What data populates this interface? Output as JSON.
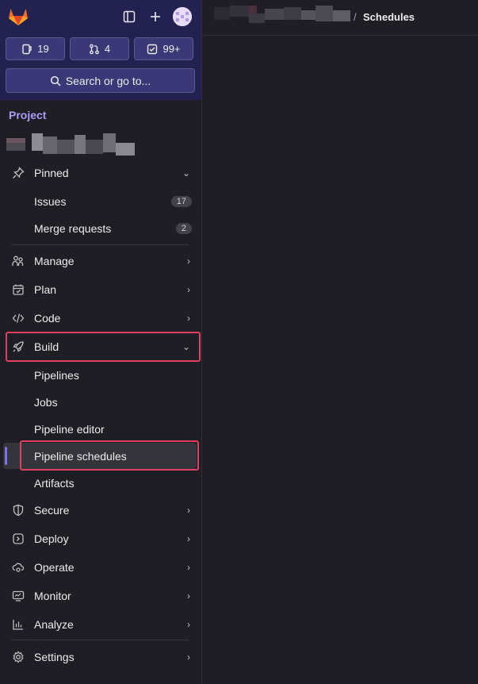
{
  "topbar": {
    "counters": [
      {
        "icon": "issues-icon",
        "value": "19"
      },
      {
        "icon": "merge-request-icon",
        "value": "4"
      },
      {
        "icon": "todo-icon",
        "value": "99+"
      }
    ],
    "search_label": "Search or go to..."
  },
  "sidebar": {
    "context_label": "Project",
    "pinned": {
      "label": "Pinned",
      "items": [
        {
          "label": "Issues",
          "count": "17"
        },
        {
          "label": "Merge requests",
          "count": "2"
        }
      ]
    },
    "sections": {
      "manage": "Manage",
      "plan": "Plan",
      "code": "Code",
      "build": "Build",
      "secure": "Secure",
      "deploy": "Deploy",
      "operate": "Operate",
      "monitor": "Monitor",
      "analyze": "Analyze",
      "settings": "Settings"
    },
    "build_items": [
      "Pipelines",
      "Jobs",
      "Pipeline editor",
      "Pipeline schedules",
      "Artifacts"
    ]
  },
  "breadcrumb": {
    "separator": "/",
    "current": "Schedules"
  },
  "colors": {
    "accent": "#7b6ff0",
    "highlight": "#e0405e",
    "topbar": "#232150"
  }
}
